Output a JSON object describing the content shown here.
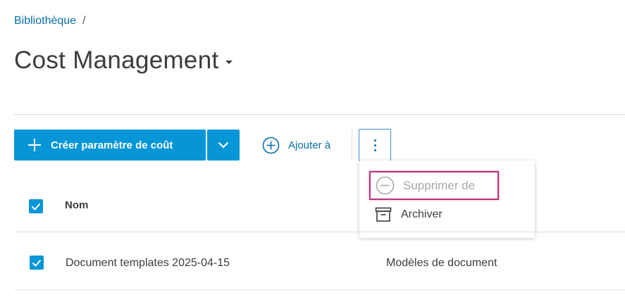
{
  "breadcrumb": {
    "root_label": "Bibliothèque",
    "separator": "/"
  },
  "page": {
    "title": "Cost Management"
  },
  "toolbar": {
    "create_label": "Créer paramètre de coût",
    "add_to_label": "Ajouter à"
  },
  "menu": {
    "items": [
      {
        "label": "Supprimer de",
        "icon": "minus-circle-icon",
        "state": "disabled",
        "highlighted": true
      },
      {
        "label": "Archiver",
        "icon": "archive-box-icon",
        "state": "enabled"
      }
    ]
  },
  "table": {
    "columns": [
      "Nom"
    ],
    "header_checked": true,
    "rows": [
      {
        "name": "Document templates 2025-04-15",
        "type": "Modèles de document",
        "checked": true
      }
    ]
  },
  "colors": {
    "accent": "#0696d7",
    "link": "#0a6eaa",
    "highlight": "#b8307a",
    "disabled_text": "#a8a8a8"
  }
}
